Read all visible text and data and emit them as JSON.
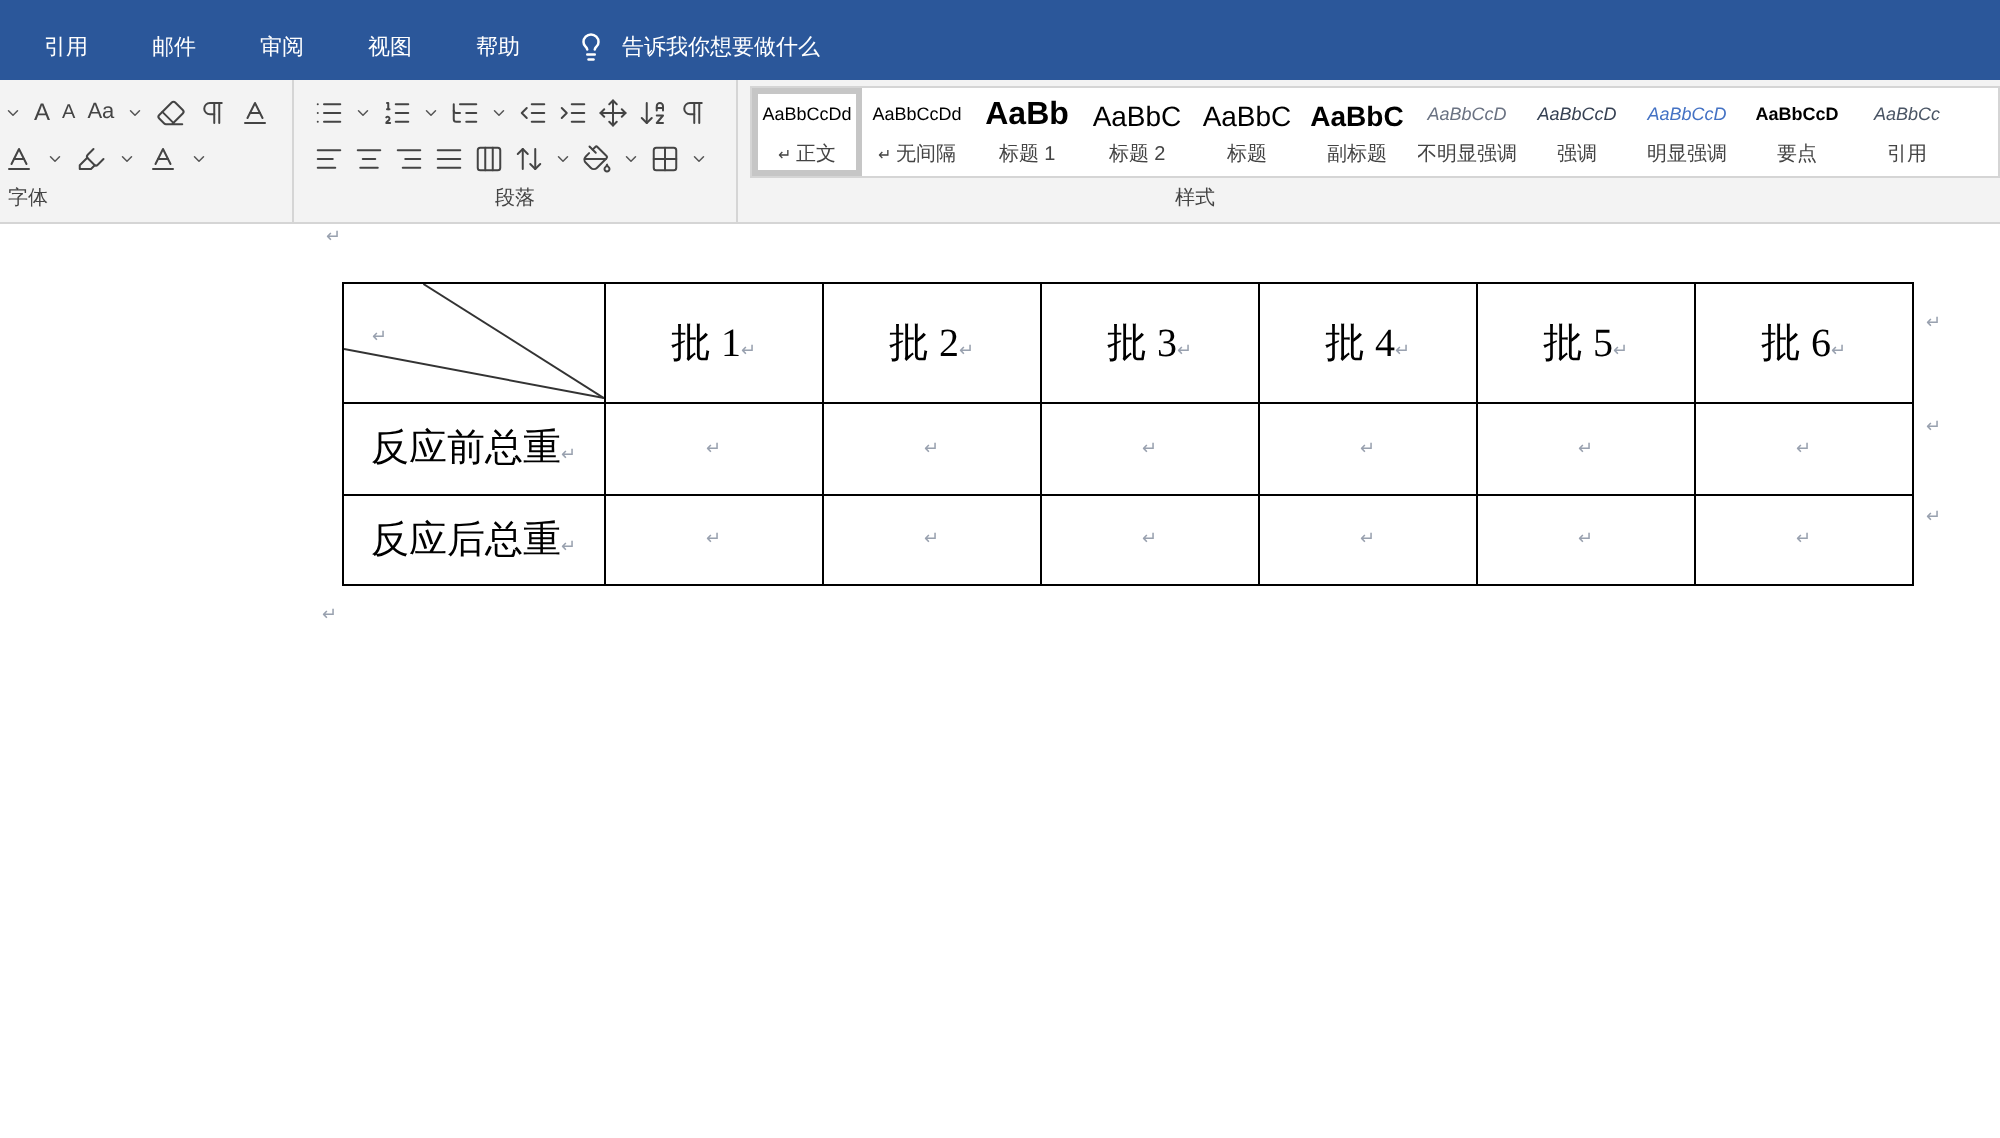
{
  "menu_tabs": [
    "引用",
    "邮件",
    "审阅",
    "视图",
    "帮助"
  ],
  "tell_me": "告诉我你想要做什么",
  "ribbon": {
    "font_group": {
      "label": "字体",
      "grow_font": "A",
      "shrink_font": "A",
      "change_case": "Aa"
    },
    "paragraph_group": {
      "label": "段落"
    },
    "styles_group": {
      "label": "样式",
      "styles": [
        {
          "preview": "AaBbCcDd",
          "name": "正文",
          "kind": "normal",
          "mark": "↵",
          "selected": true
        },
        {
          "preview": "AaBbCcDd",
          "name": "无间隔",
          "kind": "normal",
          "mark": "↵",
          "selected": false
        },
        {
          "preview": "AaBb",
          "name": "标题 1",
          "kind": "heading1",
          "selected": false
        },
        {
          "preview": "AaBbC",
          "name": "标题 2",
          "kind": "heading2",
          "selected": false
        },
        {
          "preview": "AaBbC",
          "name": "标题",
          "kind": "title",
          "selected": false
        },
        {
          "preview": "AaBbC",
          "name": "副标题",
          "kind": "subtitle",
          "selected": false
        },
        {
          "preview": "AaBbCcD",
          "name": "不明显强调",
          "kind": "subtle",
          "selected": false
        },
        {
          "preview": "AaBbCcD",
          "name": "强调",
          "kind": "emphasis",
          "selected": false
        },
        {
          "preview": "AaBbCcD",
          "name": "明显强调",
          "kind": "intense",
          "selected": false
        },
        {
          "preview": "AaBbCcD",
          "name": "要点",
          "kind": "strong",
          "selected": false
        },
        {
          "preview": "AaBbCc",
          "name": "引用",
          "kind": "quote",
          "selected": false
        }
      ]
    }
  },
  "document": {
    "top_mark": "↵",
    "bottom_mark": "↵",
    "table": {
      "corner": {
        "mark": "↵"
      },
      "header": [
        {
          "text": "批 1",
          "mark": "↵"
        },
        {
          "text": "批 2",
          "mark": "↵"
        },
        {
          "text": "批 3",
          "mark": "↵"
        },
        {
          "text": "批 4",
          "mark": "↵"
        },
        {
          "text": "批 5",
          "mark": "↵"
        },
        {
          "text": "批 6",
          "mark": "↵"
        }
      ],
      "header_end_mark": "↵",
      "rows": [
        {
          "label": "反应前总重",
          "label_mark": "↵",
          "cells": [
            "↵",
            "↵",
            "↵",
            "↵",
            "↵",
            "↵"
          ],
          "end_mark": "↵"
        },
        {
          "label": "反应后总重",
          "label_mark": "↵",
          "cells": [
            "↵",
            "↵",
            "↵",
            "↵",
            "↵",
            "↵"
          ],
          "end_mark": "↵"
        }
      ]
    }
  }
}
